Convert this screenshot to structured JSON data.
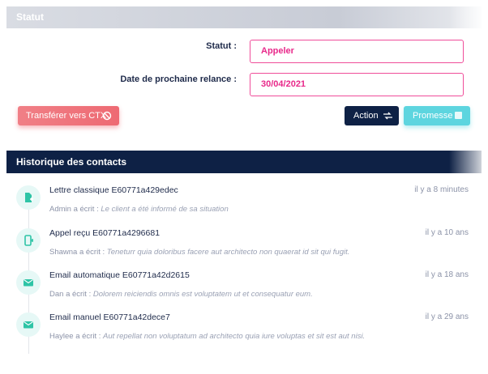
{
  "statut_section": {
    "title": "Statut",
    "fields": [
      {
        "label": "Statut :",
        "value": "Appeler"
      },
      {
        "label": "Date de prochaine relance :",
        "value": "30/04/2021"
      }
    ]
  },
  "buttons": {
    "transfer_label": "Transférer vers CTX",
    "action_label": "Action",
    "promesse_label": "Promesse"
  },
  "history": {
    "title": "Historique des contacts",
    "items": [
      {
        "icon": "file-add-icon",
        "title": "Lettre classique E60771a429edec",
        "time": "il y a 8 minutes",
        "author": "Admin a écrit :",
        "note": "Le client a été informé de sa situation"
      },
      {
        "icon": "phone-incoming-icon",
        "title": "Appel reçu E60771a4296681",
        "time": "il y a 10 ans",
        "author": "Shawna a écrit :",
        "note": "Teneturr quia doloribus facere aut architecto non quaerat id sit qui fugit."
      },
      {
        "icon": "mail-icon",
        "title": "Email automatique E60771a42d2615",
        "time": "il y a 18 ans",
        "author": "Dan a écrit :",
        "note": "Dolorem reiciendis omnis est voluptatem ut et consequatur eum."
      },
      {
        "icon": "mail-icon",
        "title": "Email manuel E60771a42dece7",
        "time": "il y a 29 ans",
        "author": "Haylee a écrit :",
        "note": "Aut repellat non voluptatum ad architecto quia iure voluptas et sit est aut nisi."
      }
    ]
  },
  "colors": {
    "navy": "#0e2145",
    "pink": "#e8298a",
    "red": "#ee6a73",
    "cyan": "#5dd5df",
    "teal": "#2ec4a6"
  }
}
